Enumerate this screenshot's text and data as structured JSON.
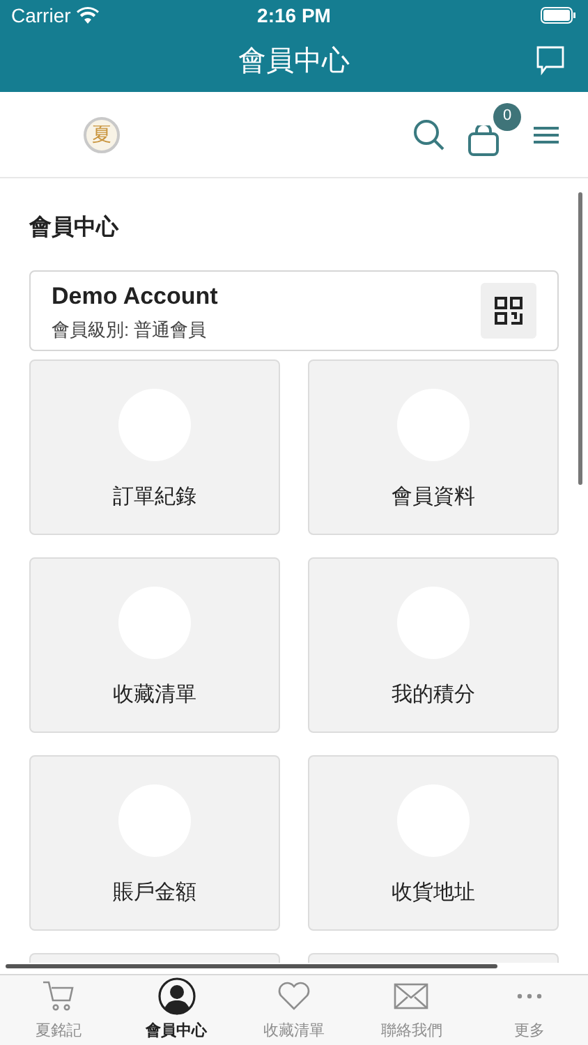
{
  "status_bar": {
    "carrier": "Carrier",
    "time": "2:16 PM"
  },
  "nav_bar": {
    "title": "會員中心"
  },
  "header": {
    "logo_char": "夏",
    "cart_count": "0"
  },
  "page_title": "會員中心",
  "account": {
    "name": "Demo Account",
    "level": "會員級別: 普通會員"
  },
  "tiles": [
    {
      "label": "訂單紀錄"
    },
    {
      "label": "會員資料"
    },
    {
      "label": "收藏清單"
    },
    {
      "label": "我的積分"
    },
    {
      "label": "賬戶金額"
    },
    {
      "label": "收貨地址"
    }
  ],
  "tab_bar": [
    {
      "kind": "cart",
      "label": "夏銘記",
      "selected": false
    },
    {
      "kind": "user",
      "label": "會員中心",
      "selected": true
    },
    {
      "kind": "heart",
      "label": "收藏清單",
      "selected": false
    },
    {
      "kind": "mail",
      "label": "聯絡我們",
      "selected": false
    },
    {
      "kind": "more",
      "label": "更多",
      "selected": false
    }
  ]
}
